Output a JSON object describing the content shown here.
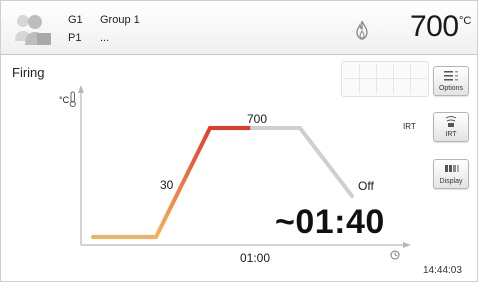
{
  "header": {
    "program_code_1": "G1",
    "program_name_1": "Group 1",
    "program_code_2": "P1",
    "program_name_2": "...",
    "temperature_value": "700",
    "temperature_unit": "°C"
  },
  "main": {
    "title": "Firing",
    "y_axis_unit": "°C",
    "labels": {
      "peak_temperature": "700",
      "heating_rate": "30",
      "cooling": "Off",
      "hold_time": "01:00"
    },
    "remaining_time": "~01:40",
    "clock": "14:44:03"
  },
  "sidebar": {
    "options_label": "Options",
    "irt_side_label": "IRT",
    "irt_button_label": "IRT",
    "display_label": "Display"
  },
  "chart_data": {
    "type": "line",
    "series": [
      {
        "values": [
          {
            "segment": "preheat",
            "temp_level": 0.0
          },
          {
            "segment": "heating",
            "rate": 30
          },
          {
            "segment": "hold",
            "temperature": 700,
            "duration": "01:00"
          },
          {
            "segment": "cooling",
            "state": "Off"
          }
        ]
      }
    ],
    "colors": {
      "preheat": "#f2b066",
      "heating_start": "#f7b25a",
      "heating_end": "#e23b2c",
      "hold_active": "#e23b2c",
      "hold_inactive": "#cfcfcf",
      "cooling": "#cfcfcf"
    }
  }
}
